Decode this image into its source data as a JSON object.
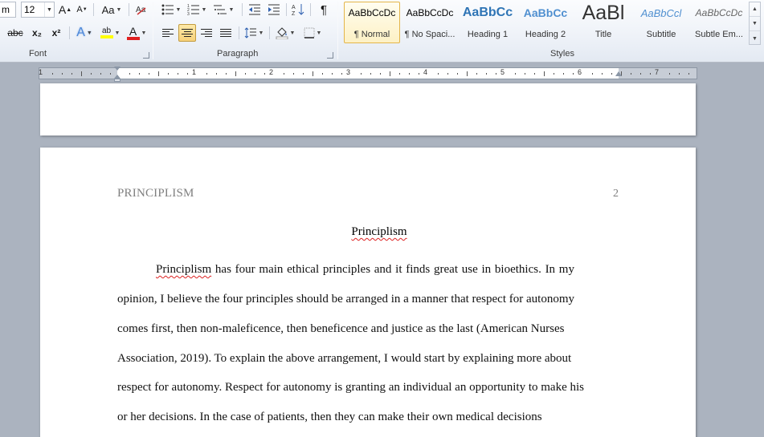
{
  "ribbon": {
    "font": {
      "font_name": "m",
      "font_size": "12",
      "grow_label": "A",
      "shrink_label": "A",
      "change_case_label": "Aa",
      "strikethrough_label": "abc",
      "subscript_label": "x₂",
      "superscript_label": "x²",
      "text_effects_label": "A",
      "highlight_label": "ab",
      "font_color_label": "A",
      "group_label": "Font"
    },
    "paragraph": {
      "group_label": "Paragraph",
      "pilcrow_label": "¶",
      "sort_label": "A↓Z"
    },
    "styles": {
      "group_label": "Styles",
      "items": [
        {
          "sample": "AaBbCcDc",
          "name": "¶ Normal"
        },
        {
          "sample": "AaBbCcDc",
          "name": "¶ No Spaci..."
        },
        {
          "sample": "AaBbCc",
          "name": "Heading 1"
        },
        {
          "sample": "AaBbCc",
          "name": "Heading 2"
        },
        {
          "sample": "AaBl",
          "name": "Title"
        },
        {
          "sample": "AaBbCcl",
          "name": "Subtitle"
        },
        {
          "sample": "AaBbCcDc",
          "name": "Subtle Em..."
        }
      ]
    }
  },
  "ruler": {
    "numbers": [
      "1",
      "1",
      "2",
      "3",
      "4",
      "5",
      "6",
      "7"
    ]
  },
  "document": {
    "header_title": "PRINCIPLISM",
    "page_number": "2",
    "title": "Principlism",
    "lines": [
      {
        "first": "Principlism",
        "rest": " has four main ethical principles and it finds great use in bioethics. In my"
      },
      {
        "text": "opinion, I believe the four principles should be arranged in a manner that respect for autonomy"
      },
      {
        "text": "comes first, then non-maleficence, then beneficence and justice as the last (American Nurses"
      },
      {
        "text": "Association, 2019). To explain the above arrangement, I would start by explaining more about"
      },
      {
        "text": "respect for autonomy. Respect for autonomy is granting an individual an opportunity to make his"
      },
      {
        "text": "or her decisions. In the case of patients, then they can make their own medical decisions"
      }
    ]
  },
  "colors": {
    "highlight": "#ffff00",
    "font_color": "#e02020",
    "heading_blue": "#2e74b5",
    "selected_style": "#fdf1c5"
  }
}
